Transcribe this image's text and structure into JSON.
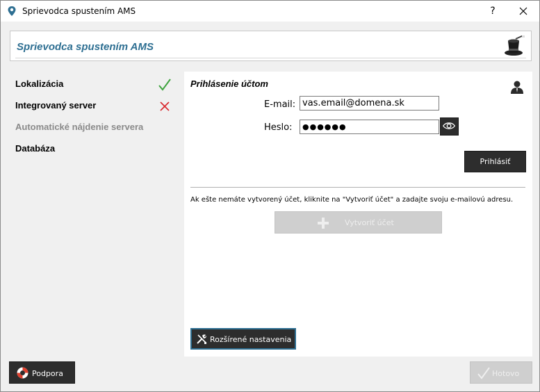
{
  "window": {
    "title": "Sprievodca spustením AMS",
    "help_label": "?"
  },
  "header": {
    "title": "Sprievodca spustením AMS"
  },
  "steps": [
    {
      "label": "Lokalizácia",
      "status": "done"
    },
    {
      "label": "Integrovaný server",
      "status": "failed"
    },
    {
      "label": "Automatické nájdenie servera",
      "status": "disabled"
    },
    {
      "label": "Databáza",
      "status": "pending"
    }
  ],
  "login": {
    "section_title": "Prihlásenie účtom",
    "email_label": "E-mail:",
    "email_value": "vas.email@domena.sk",
    "password_label": "Heslo:",
    "password_value": "●●●●●●",
    "login_button": "Prihlásiť",
    "info_text": "Ak ešte nemáte vytvorený účet, kliknite na \"Vytvoriť účet\" a zadajte svoju e-mailovú adresu.",
    "create_account_button": "Vytvoriť účet",
    "advanced_button": "Rozšírené nastavenia"
  },
  "footer": {
    "support_button": "Podpora",
    "done_button": "Hotovo"
  },
  "colors": {
    "accent": "#2e6f92",
    "dark_button": "#2d2d2d",
    "success": "#3ea33e",
    "error": "#d9262c"
  }
}
